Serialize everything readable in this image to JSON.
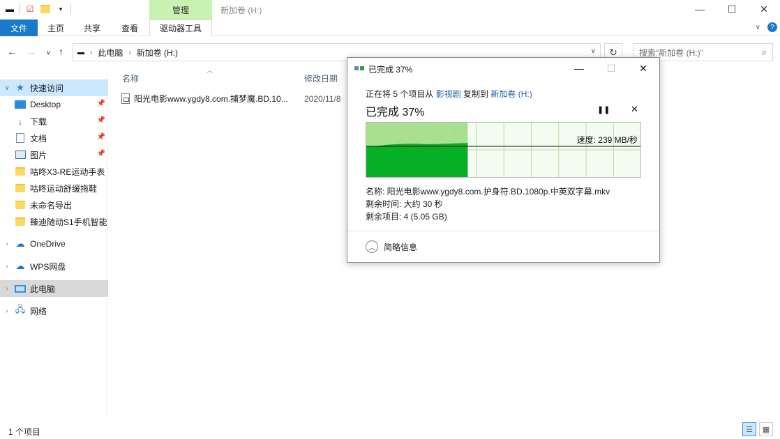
{
  "window": {
    "title": "新加卷 (H:)",
    "context_tab": "管理",
    "controls": {
      "minimize": "—",
      "maximize": "☐",
      "close": "✕"
    }
  },
  "ribbon": {
    "tabs": [
      {
        "label": "文件"
      },
      {
        "label": "主页"
      },
      {
        "label": "共享"
      },
      {
        "label": "查看"
      },
      {
        "label": "驱动器工具"
      }
    ],
    "help": "?"
  },
  "address": {
    "crumbs": [
      "此电脑",
      "新加卷 (H:)"
    ],
    "search_placeholder": "搜索\"新加卷 (H:)\""
  },
  "sidebar": {
    "items": [
      {
        "label": "快速访问"
      },
      {
        "label": "Desktop"
      },
      {
        "label": "下载"
      },
      {
        "label": "文档"
      },
      {
        "label": "图片"
      },
      {
        "label": "咕咚X3-RE运动手表"
      },
      {
        "label": "咕咚运动舒缓拖鞋"
      },
      {
        "label": "未命名导出"
      },
      {
        "label": "臻迪随动S1手机智能"
      },
      {
        "label": "OneDrive"
      },
      {
        "label": "WPS网盘"
      },
      {
        "label": "此电脑"
      },
      {
        "label": "网络"
      }
    ]
  },
  "file_list": {
    "columns": [
      "名称",
      "修改日期"
    ],
    "rows": [
      {
        "name": "阳光电影www.ygdy8.com.捕梦魔.BD.10...",
        "modified": "2020/11/8"
      }
    ]
  },
  "status": {
    "item_count": "1 个项目"
  },
  "copy_dialog": {
    "title": "已完成 37%",
    "copy_prefix": "正在将 5 个项目从",
    "source": "影视剧",
    "copy_mid": "复制到",
    "destination": "新加卷 (H:)",
    "progress_label": "已完成 37%",
    "progress": 0.37,
    "speed": "速度: 239 MB/秒",
    "name_line": "名称: 阳光电影www.ygdy8.com.护身符.BD.1080p.中英双字幕.mkv",
    "time_line": "剩余时间: 大约 30 秒",
    "items_line": "剩余项目: 4 (5.05 GB)",
    "less_details": "简略信息",
    "speed_series": [
      168,
      170,
      178,
      181,
      183,
      183,
      181,
      182,
      184,
      186,
      188
    ]
  },
  "colors": {
    "accent": "#1979ca",
    "manage_tab": "#c9f1b2",
    "graph_fill": "#06b025",
    "graph_done": "#a8e08e"
  }
}
